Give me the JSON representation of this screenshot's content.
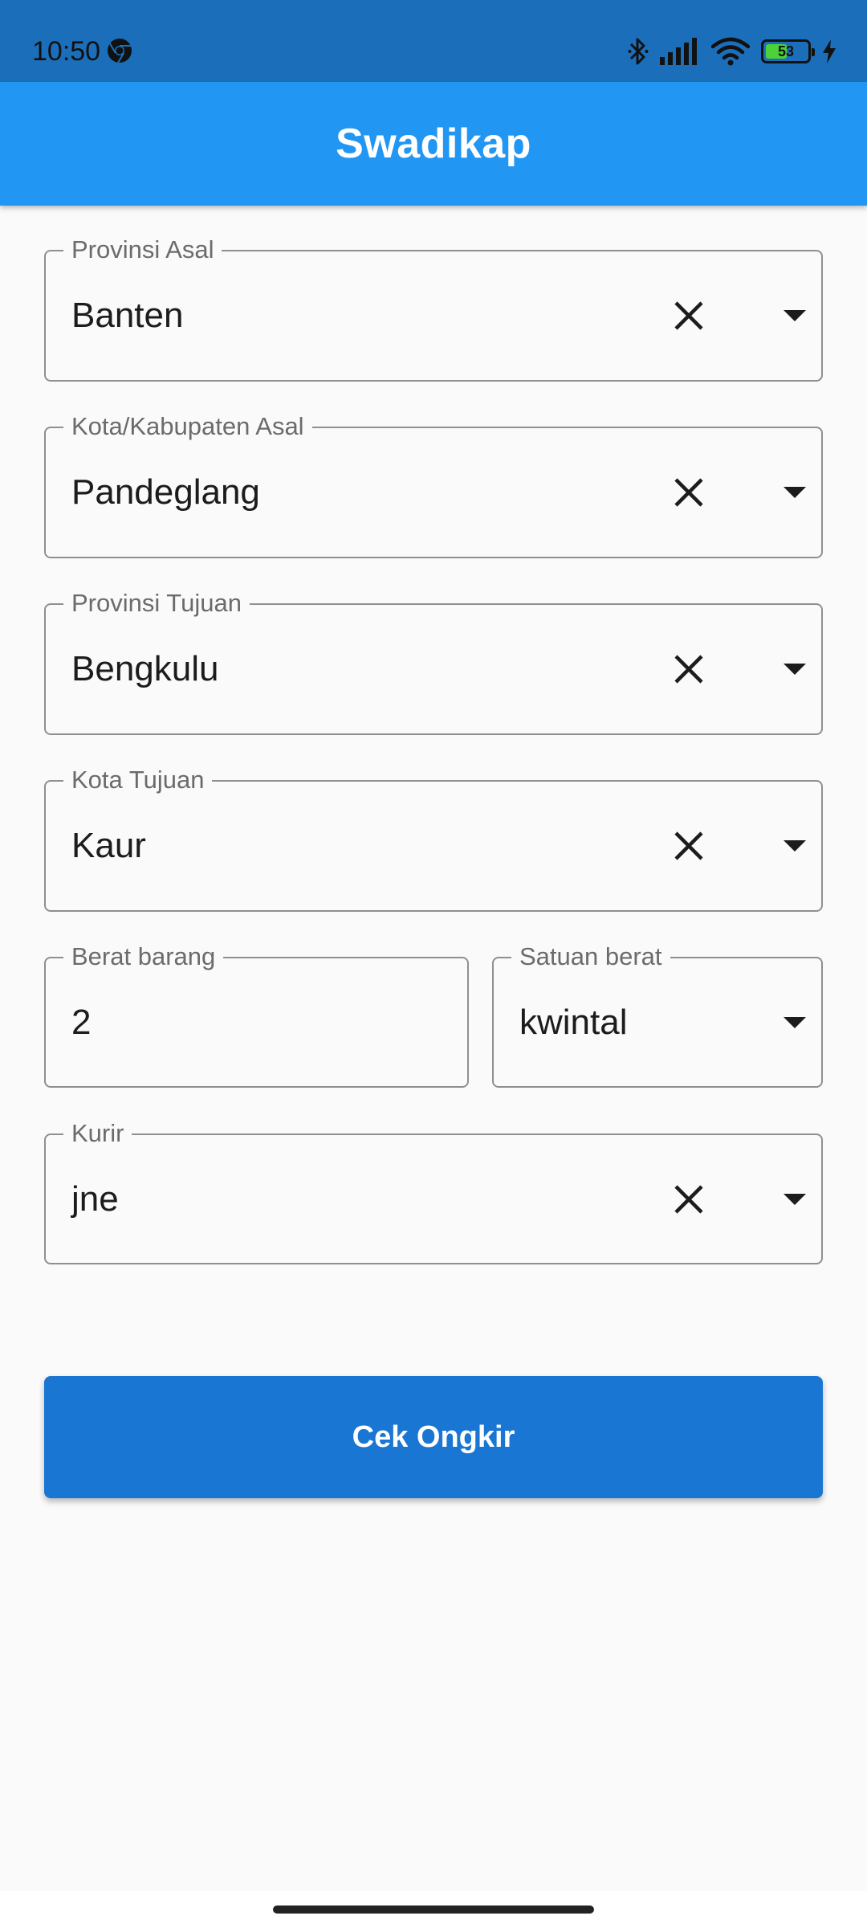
{
  "status_bar": {
    "time": "10:50",
    "battery_level": "53",
    "battery_fraction": 0.53,
    "icons": [
      "chrome-icon",
      "bluetooth-icon",
      "signal-icon",
      "wifi-icon",
      "battery-icon",
      "charging-icon"
    ]
  },
  "app_bar": {
    "title": "Swadikap",
    "color": "#2196f3"
  },
  "form": {
    "provinsi_asal": {
      "label": "Provinsi Asal",
      "value": "Banten"
    },
    "kota_asal": {
      "label": "Kota/Kabupaten Asal",
      "value": "Pandeglang"
    },
    "provinsi_tujuan": {
      "label": "Provinsi Tujuan",
      "value": "Bengkulu"
    },
    "kota_tujuan": {
      "label": "Kota Tujuan",
      "value": "Kaur"
    },
    "berat_barang": {
      "label": "Berat barang",
      "value": "2"
    },
    "satuan_berat": {
      "label": "Satuan berat",
      "value": "kwintal"
    },
    "kurir": {
      "label": "Kurir",
      "value": "jne"
    }
  },
  "actions": {
    "cek_ongkir_label": "Cek Ongkir",
    "button_color": "#1976d2"
  }
}
